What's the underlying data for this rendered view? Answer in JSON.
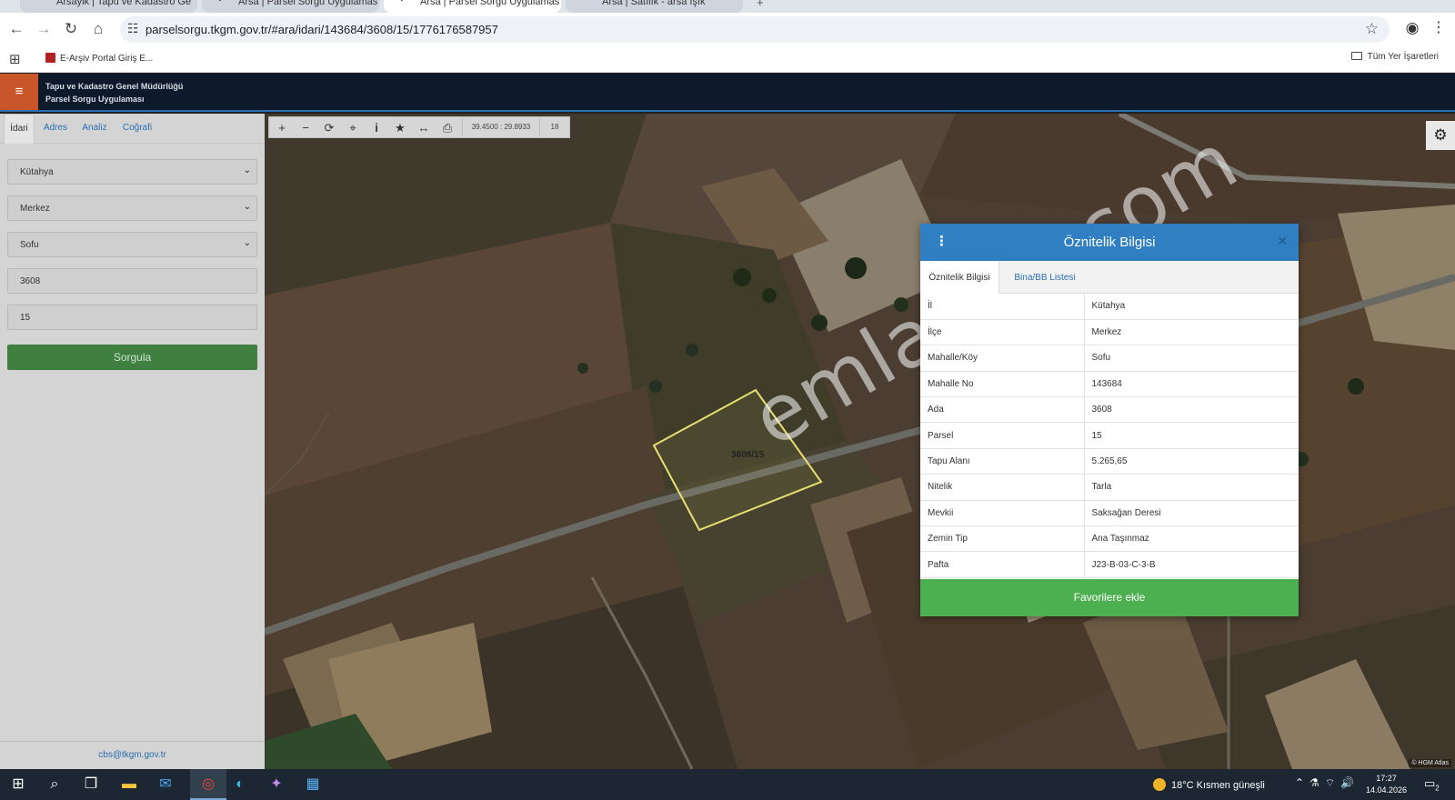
{
  "browser": {
    "tabs": [
      {
        "title": "Arsaylk | Tapu ve Kadastro Ge"
      },
      {
        "title": "Arsa | Parsel Sorgu Uygulamas"
      },
      {
        "title": "Arsa | Parsel Sorgu Uygulamas"
      },
      {
        "title": "Arsa | Satılık - arsa ışık"
      }
    ],
    "url": "parselsorgu.tkgm.gov.tr/#ara/idari/143684/3608/15/1776176587957",
    "bookmark": "E-Arşiv Portal Giriş E...",
    "all_bookmarks": "Tüm Yer İşaretleri"
  },
  "app": {
    "title_line1": "Tapu ve Kadastro Genel Müdürlüğü",
    "title_line2": "Parsel Sorgu Uygulaması"
  },
  "left_panel": {
    "tabs": [
      "İdari",
      "Adres",
      "Analiz",
      "Coğrafi"
    ],
    "active_tab": "İdari",
    "il": "Kütahya",
    "ilce": "Merkez",
    "mahalle": "Sofu",
    "ada": "3608",
    "parsel": "15",
    "submit": "Sorgula",
    "footer_email": "cbs@tkgm.gov.tr"
  },
  "map": {
    "coords": "39.4500 : 29.8933",
    "zoom": "18",
    "parcel_label": "3608/15",
    "watermark": "emlakjet.com",
    "attribution": "© HGM Atlas"
  },
  "popup": {
    "title": "Öznitelik Bilgisi",
    "tabs": [
      "Öznitelik Bilgisi",
      "Bina/BB Listesi"
    ],
    "rows": [
      {
        "key": "İl",
        "value": "Kütahya"
      },
      {
        "key": "İlçe",
        "value": "Merkez"
      },
      {
        "key": "Mahalle/Köy",
        "value": "Sofu"
      },
      {
        "key": "Mahalle No",
        "value": "143684"
      },
      {
        "key": "Ada",
        "value": "3608"
      },
      {
        "key": "Parsel",
        "value": "15"
      },
      {
        "key": "Tapu Alanı",
        "value": "5.265,65"
      },
      {
        "key": "Nitelik",
        "value": "Tarla"
      },
      {
        "key": "Mevkii",
        "value": "Saksağan Deresi"
      },
      {
        "key": "Zemin Tip",
        "value": "Ana Taşınmaz"
      },
      {
        "key": "Pafta",
        "value": "J23-B-03-C-3-B"
      }
    ],
    "favorite_button": "Favorilere ekle"
  },
  "taskbar": {
    "weather": "18°C  Kısmen güneşli",
    "time": "17:27",
    "date": "14.04.2026",
    "notifications": "2"
  }
}
